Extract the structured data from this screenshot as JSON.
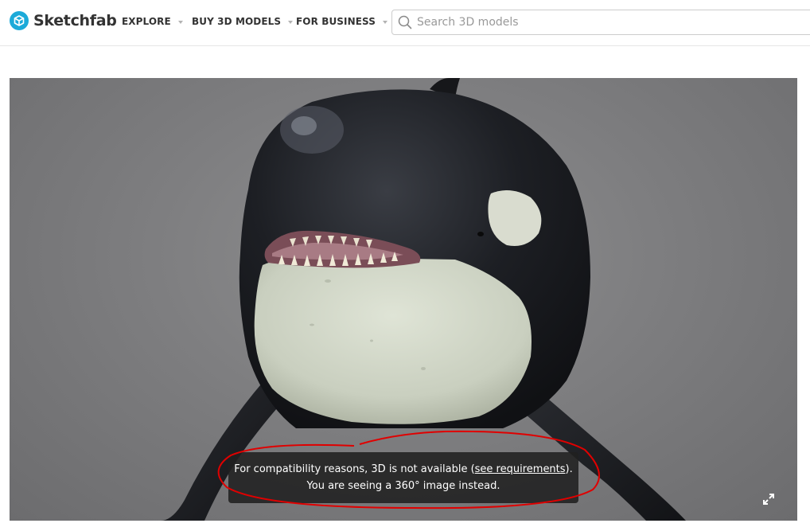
{
  "header": {
    "brand": "Sketchfab",
    "nav": [
      {
        "label": "EXPLORE"
      },
      {
        "label": "BUY 3D MODELS"
      },
      {
        "label": "FOR BUSINESS"
      }
    ],
    "search": {
      "placeholder": "Search 3D models",
      "value": ""
    }
  },
  "viewer": {
    "notice": {
      "line1_before": "For compatibility reasons, 3D is not available (",
      "link": "see requirements",
      "line1_after": ").",
      "line2": "You are seeing a 360° image instead."
    }
  },
  "colors": {
    "brand": "#1caad9",
    "annotation": "#e00000"
  },
  "icons": {
    "logo": "sketchfab-cube-icon",
    "search": "search-icon",
    "fullscreen": "fullscreen-icon",
    "caret": "chevron-down-icon"
  }
}
